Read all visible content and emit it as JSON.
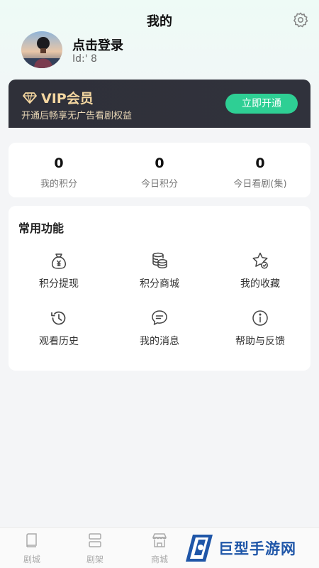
{
  "header": {
    "title": "我的"
  },
  "profile": {
    "login_text": "点击登录",
    "user_id": "Id:'            8"
  },
  "vip": {
    "title": "VIP会员",
    "subtitle": "开通后畅享无广告看剧权益",
    "button": "立即开通"
  },
  "stats": [
    {
      "value": "0",
      "label": "我的积分"
    },
    {
      "value": "0",
      "label": "今日积分"
    },
    {
      "value": "0",
      "label": "今日看剧(集)"
    }
  ],
  "functions": {
    "title": "常用功能",
    "items": [
      {
        "label": "积分提现",
        "icon": "money-bag-icon"
      },
      {
        "label": "积分商城",
        "icon": "coin-stack-icon"
      },
      {
        "label": "我的收藏",
        "icon": "star-check-icon"
      },
      {
        "label": "观看历史",
        "icon": "history-icon"
      },
      {
        "label": "我的消息",
        "icon": "message-icon"
      },
      {
        "label": "帮助与反馈",
        "icon": "info-icon"
      }
    ]
  },
  "bottom_nav": [
    {
      "label": "剧城",
      "icon": "book-icon"
    },
    {
      "label": "剧架",
      "icon": "shelf-icon"
    },
    {
      "label": "商城",
      "icon": "store-icon"
    }
  ],
  "watermark": {
    "text": "巨型手游网"
  },
  "colors": {
    "accent": "#2ecf94",
    "vip_gold": "#f4d6a0",
    "vip_bg": "#2f3039"
  }
}
